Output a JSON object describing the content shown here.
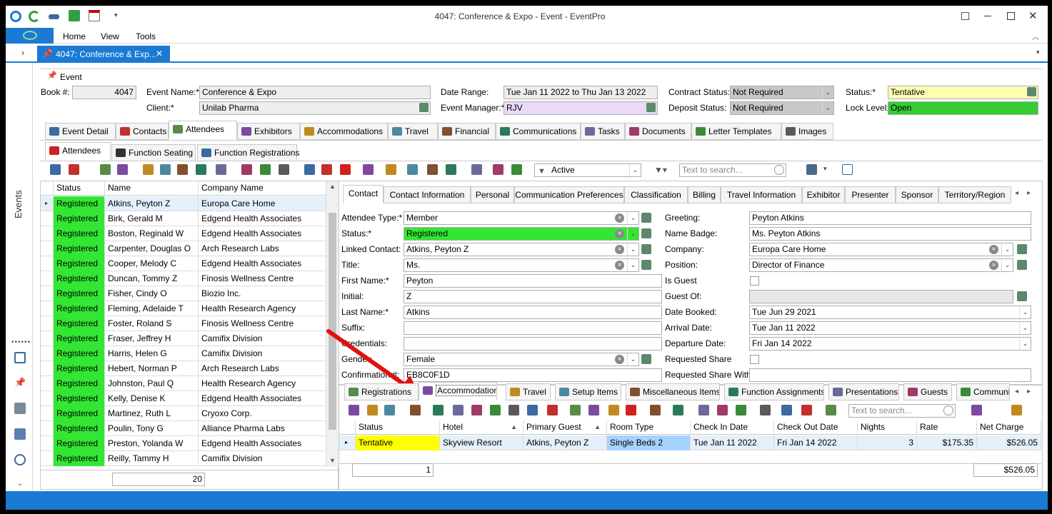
{
  "window": {
    "title": "4047: Conference & Expo - Event - EventPro"
  },
  "ribbon": {
    "menus": [
      "Home",
      "View",
      "Tools"
    ]
  },
  "doc_tab": {
    "label": "4047: Conference & Exp..."
  },
  "sidebar": {
    "label": "Events"
  },
  "event": {
    "section_label": "Event",
    "book_label": "Book #:",
    "book_value": "4047",
    "name_label": "Event Name:*",
    "name_value": "Conference & Expo",
    "client_label": "Client:*",
    "client_value": "Unilab Pharma",
    "date_label": "Date Range:",
    "date_value": "Tue Jan 11 2022 to Thu Jan 13 2022",
    "manager_label": "Event Manager:*",
    "manager_value": "RJV",
    "contract_label": "Contract Status:",
    "contract_value": "Not Required",
    "deposit_label": "Deposit Status:",
    "deposit_value": "Not Required",
    "status_label": "Status:*",
    "status_value": "Tentative",
    "lock_label": "Lock Level:",
    "lock_value": "Open"
  },
  "main_tabs": [
    "Event Detail",
    "Contacts",
    "Attendees",
    "Exhibitors",
    "Accommodations",
    "Travel",
    "Financial",
    "Communications",
    "Tasks",
    "Documents",
    "Letter Templates",
    "Images"
  ],
  "sub_tabs": [
    "Attendees",
    "Function Seating",
    "Function Registrations"
  ],
  "toolbar": {
    "filter_value": "Active",
    "search_placeholder": "Text to search..."
  },
  "attendee_grid": {
    "columns": [
      "Status",
      "Name",
      "Company Name"
    ],
    "rows": [
      [
        "Registered",
        "Atkins, Peyton Z",
        "Europa Care Home"
      ],
      [
        "Registered",
        "Birk, Gerald M",
        "Edgend Health Associates"
      ],
      [
        "Registered",
        "Boston, Reginald W",
        "Edgend Health Associates"
      ],
      [
        "Registered",
        "Carpenter, Douglas O",
        "Arch Research Labs"
      ],
      [
        "Registered",
        "Cooper, Melody C",
        "Edgend Health Associates"
      ],
      [
        "Registered",
        "Duncan, Tommy Z",
        "Finosis Wellness Centre"
      ],
      [
        "Registered",
        "Fisher, Cindy O",
        "Biozio Inc."
      ],
      [
        "Registered",
        "Fleming, Adelaide T",
        "Health Research Agency"
      ],
      [
        "Registered",
        "Foster, Roland S",
        "Finosis Wellness Centre"
      ],
      [
        "Registered",
        "Fraser, Jeffrey H",
        "Camifix Division"
      ],
      [
        "Registered",
        "Harris, Helen G",
        "Camifix Division"
      ],
      [
        "Registered",
        "Hebert, Norman P",
        "Arch Research Labs"
      ],
      [
        "Registered",
        "Johnston, Paul Q",
        "Health Research Agency"
      ],
      [
        "Registered",
        "Kelly, Denise K",
        "Edgend Health Associates"
      ],
      [
        "Registered",
        "Martinez, Ruth L",
        "Cryoxo Corp."
      ],
      [
        "Registered",
        "Poulin, Tony G",
        "Alliance Pharma Labs"
      ],
      [
        "Registered",
        "Preston, Yolanda W",
        "Edgend Health Associates"
      ],
      [
        "Registered",
        "Reilly, Tammy H",
        "Camifix Division"
      ]
    ],
    "count": "20"
  },
  "detail_tabs": [
    "Contact",
    "Contact Information",
    "Personal",
    "Communication Preferences",
    "Classification",
    "Billing",
    "Travel Information",
    "Exhibitor",
    "Presenter",
    "Sponsor",
    "Territory/Region"
  ],
  "contact": {
    "attendee_type_label": "Attendee Type:*",
    "attendee_type_value": "Member",
    "status_label": "Status:*",
    "status_value": "Registered",
    "linked_label": "Linked Contact:",
    "linked_value": "Atkins, Peyton Z",
    "title_label": "Title:",
    "title_value": "Ms.",
    "first_label": "First Name:*",
    "first_value": "Peyton",
    "initial_label": "Initial:",
    "initial_value": "Z",
    "last_label": "Last Name:*",
    "last_value": "Atkins",
    "suffix_label": "Suffix:",
    "suffix_value": "",
    "credentials_label": "Credentials:",
    "credentials_value": "",
    "gender_label": "Gender:",
    "gender_value": "Female",
    "confirm_label": "Confirmation #:",
    "confirm_value": "EB8C0F1D",
    "greeting_label": "Greeting:",
    "greeting_value": "Peyton Atkins",
    "badge_label": "Name Badge:",
    "badge_value": "Ms. Peyton Atkins",
    "company_label": "Company:",
    "company_value": "Europa Care Home",
    "position_label": "Position:",
    "position_value": "Director of Finance",
    "guest_label": "Is Guest",
    "guest_of_label": "Guest Of:",
    "booked_label": "Date Booked:",
    "booked_value": "Tue Jun 29 2021",
    "arrival_label": "Arrival Date:",
    "arrival_value": "Tue Jan 11 2022",
    "departure_label": "Departure Date:",
    "departure_value": "Fri Jan 14 2022",
    "share_label": "Requested Share",
    "share_with_label": "Requested Share With:"
  },
  "bottom_tabs": [
    "Registrations",
    "Accommodations",
    "Travel",
    "Setup Items",
    "Miscellaneous Items",
    "Function Assignments",
    "Presentations",
    "Guests",
    "Communica"
  ],
  "accom_grid": {
    "columns": [
      "Status",
      "Hotel",
      "Primary Guest",
      "Room Type",
      "Check In Date",
      "Check Out Date",
      "Nights",
      "Rate",
      "Net Charge"
    ],
    "rows": [
      [
        "Tentative",
        "Skyview Resort",
        "Atkins, Peyton Z",
        "Single Beds 2",
        "Tue Jan 11 2022",
        "Fri Jan 14 2022",
        "3",
        "$175.35",
        "$526.05"
      ]
    ],
    "count": "1",
    "total": "$526.05"
  },
  "colors": {
    "registered": "#33e633",
    "tentative": "#ffff00",
    "open": "#33cc33",
    "room": "#a6d2ff",
    "accent": "#1a7ad4",
    "arrow": "#e01010"
  }
}
